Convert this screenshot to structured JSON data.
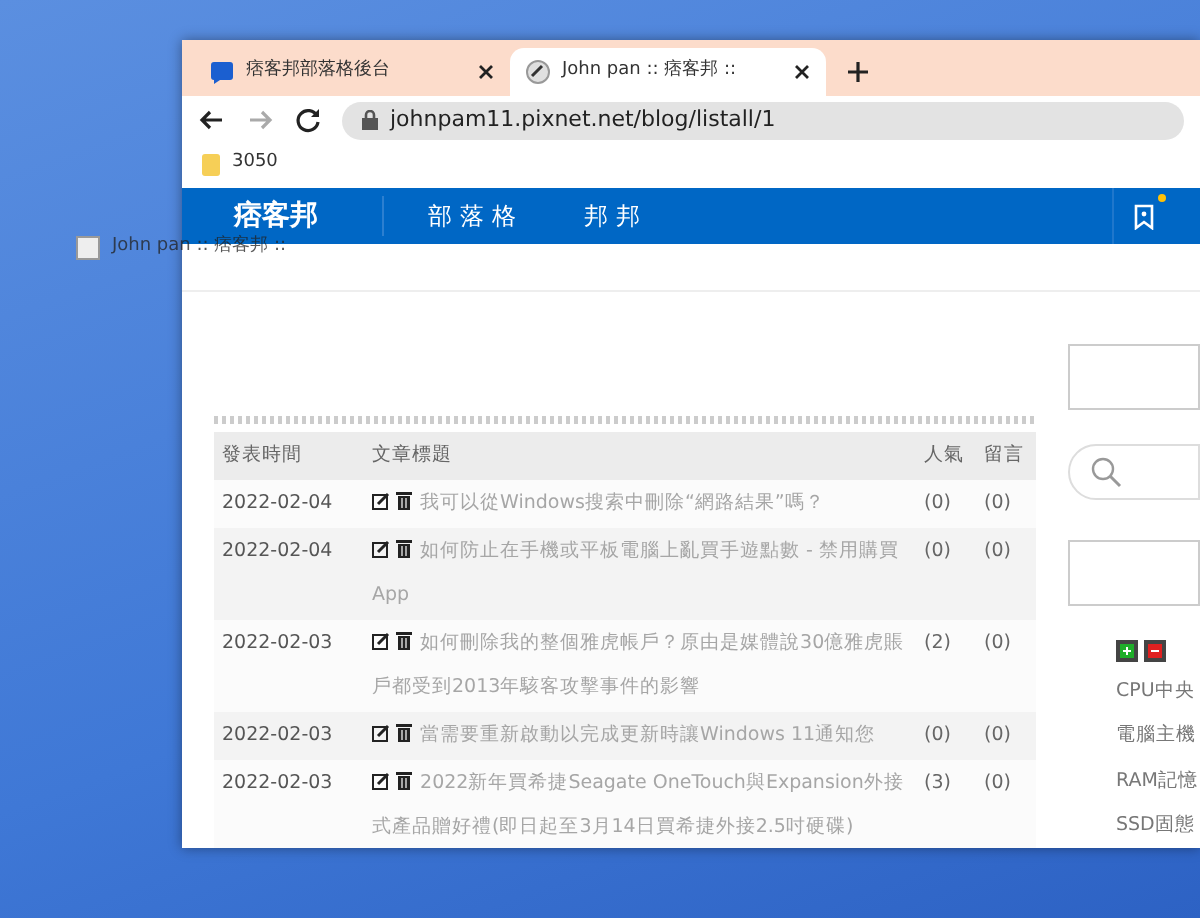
{
  "desktop": {
    "drag_ghost": {
      "label": "John pan :: 痞客邦 ::"
    }
  },
  "browser": {
    "tabs": [
      {
        "title": "痞客邦部落格後台",
        "selected": false
      },
      {
        "title": "John pan :: 痞客邦 ::",
        "selected": true
      }
    ],
    "url": "johnpam11.pixnet.net/blog/listall/1",
    "bookmarks": [
      "3050"
    ]
  },
  "site": {
    "logo": "痞客邦",
    "nav": [
      "部落格",
      "邦邦"
    ],
    "notification": true
  },
  "table": {
    "columns": [
      "發表時間",
      "文章標題",
      "人氣",
      "留言"
    ],
    "rows": [
      {
        "date": "2022-02-04",
        "title": "我可以從Windows搜索中刪除“網路結果”嗎？",
        "views": "(0)",
        "comments": "(0)"
      },
      {
        "date": "2022-02-04",
        "title": "如何防止在手機或平板電腦上亂買手遊點數 - 禁用購買App",
        "views": "(0)",
        "comments": "(0)"
      },
      {
        "date": "2022-02-03",
        "title": "如何刪除我的整個雅虎帳戶？原由是媒體說30億雅虎賬戶都受到2013年駭客攻擊事件的影響",
        "views": "(2)",
        "comments": "(0)"
      },
      {
        "date": "2022-02-03",
        "title": "當需要重新啟動以完成更新時讓Windows 11通知您",
        "views": "(0)",
        "comments": "(0)"
      },
      {
        "date": "2022-02-03",
        "title": "2022新年買希捷Seagate OneTouch與Expansion外接式產品贈好禮(即日起至3月14日買希捷外接2.5吋硬碟)",
        "views": "(3)",
        "comments": "(0)"
      }
    ]
  },
  "sidebar": {
    "links": [
      "CPU中央",
      "電腦主機",
      "RAM記憶",
      "SSD固態"
    ]
  }
}
